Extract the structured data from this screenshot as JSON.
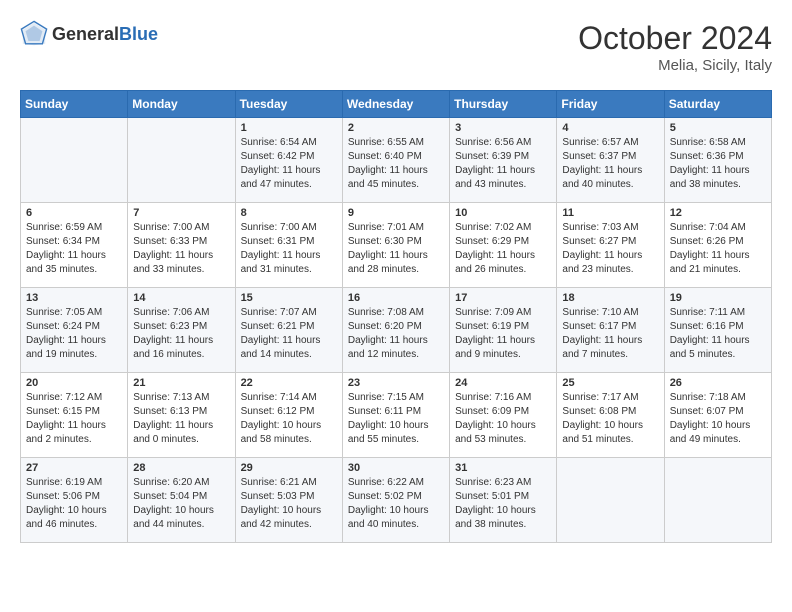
{
  "header": {
    "logo_general": "General",
    "logo_blue": "Blue",
    "month_title": "October 2024",
    "location": "Melia, Sicily, Italy"
  },
  "weekdays": [
    "Sunday",
    "Monday",
    "Tuesday",
    "Wednesday",
    "Thursday",
    "Friday",
    "Saturday"
  ],
  "weeks": [
    [
      {
        "day": "",
        "sunrise": "",
        "sunset": "",
        "daylight": ""
      },
      {
        "day": "",
        "sunrise": "",
        "sunset": "",
        "daylight": ""
      },
      {
        "day": "1",
        "sunrise": "Sunrise: 6:54 AM",
        "sunset": "Sunset: 6:42 PM",
        "daylight": "Daylight: 11 hours and 47 minutes."
      },
      {
        "day": "2",
        "sunrise": "Sunrise: 6:55 AM",
        "sunset": "Sunset: 6:40 PM",
        "daylight": "Daylight: 11 hours and 45 minutes."
      },
      {
        "day": "3",
        "sunrise": "Sunrise: 6:56 AM",
        "sunset": "Sunset: 6:39 PM",
        "daylight": "Daylight: 11 hours and 43 minutes."
      },
      {
        "day": "4",
        "sunrise": "Sunrise: 6:57 AM",
        "sunset": "Sunset: 6:37 PM",
        "daylight": "Daylight: 11 hours and 40 minutes."
      },
      {
        "day": "5",
        "sunrise": "Sunrise: 6:58 AM",
        "sunset": "Sunset: 6:36 PM",
        "daylight": "Daylight: 11 hours and 38 minutes."
      }
    ],
    [
      {
        "day": "6",
        "sunrise": "Sunrise: 6:59 AM",
        "sunset": "Sunset: 6:34 PM",
        "daylight": "Daylight: 11 hours and 35 minutes."
      },
      {
        "day": "7",
        "sunrise": "Sunrise: 7:00 AM",
        "sunset": "Sunset: 6:33 PM",
        "daylight": "Daylight: 11 hours and 33 minutes."
      },
      {
        "day": "8",
        "sunrise": "Sunrise: 7:00 AM",
        "sunset": "Sunset: 6:31 PM",
        "daylight": "Daylight: 11 hours and 31 minutes."
      },
      {
        "day": "9",
        "sunrise": "Sunrise: 7:01 AM",
        "sunset": "Sunset: 6:30 PM",
        "daylight": "Daylight: 11 hours and 28 minutes."
      },
      {
        "day": "10",
        "sunrise": "Sunrise: 7:02 AM",
        "sunset": "Sunset: 6:29 PM",
        "daylight": "Daylight: 11 hours and 26 minutes."
      },
      {
        "day": "11",
        "sunrise": "Sunrise: 7:03 AM",
        "sunset": "Sunset: 6:27 PM",
        "daylight": "Daylight: 11 hours and 23 minutes."
      },
      {
        "day": "12",
        "sunrise": "Sunrise: 7:04 AM",
        "sunset": "Sunset: 6:26 PM",
        "daylight": "Daylight: 11 hours and 21 minutes."
      }
    ],
    [
      {
        "day": "13",
        "sunrise": "Sunrise: 7:05 AM",
        "sunset": "Sunset: 6:24 PM",
        "daylight": "Daylight: 11 hours and 19 minutes."
      },
      {
        "day": "14",
        "sunrise": "Sunrise: 7:06 AM",
        "sunset": "Sunset: 6:23 PM",
        "daylight": "Daylight: 11 hours and 16 minutes."
      },
      {
        "day": "15",
        "sunrise": "Sunrise: 7:07 AM",
        "sunset": "Sunset: 6:21 PM",
        "daylight": "Daylight: 11 hours and 14 minutes."
      },
      {
        "day": "16",
        "sunrise": "Sunrise: 7:08 AM",
        "sunset": "Sunset: 6:20 PM",
        "daylight": "Daylight: 11 hours and 12 minutes."
      },
      {
        "day": "17",
        "sunrise": "Sunrise: 7:09 AM",
        "sunset": "Sunset: 6:19 PM",
        "daylight": "Daylight: 11 hours and 9 minutes."
      },
      {
        "day": "18",
        "sunrise": "Sunrise: 7:10 AM",
        "sunset": "Sunset: 6:17 PM",
        "daylight": "Daylight: 11 hours and 7 minutes."
      },
      {
        "day": "19",
        "sunrise": "Sunrise: 7:11 AM",
        "sunset": "Sunset: 6:16 PM",
        "daylight": "Daylight: 11 hours and 5 minutes."
      }
    ],
    [
      {
        "day": "20",
        "sunrise": "Sunrise: 7:12 AM",
        "sunset": "Sunset: 6:15 PM",
        "daylight": "Daylight: 11 hours and 2 minutes."
      },
      {
        "day": "21",
        "sunrise": "Sunrise: 7:13 AM",
        "sunset": "Sunset: 6:13 PM",
        "daylight": "Daylight: 11 hours and 0 minutes."
      },
      {
        "day": "22",
        "sunrise": "Sunrise: 7:14 AM",
        "sunset": "Sunset: 6:12 PM",
        "daylight": "Daylight: 10 hours and 58 minutes."
      },
      {
        "day": "23",
        "sunrise": "Sunrise: 7:15 AM",
        "sunset": "Sunset: 6:11 PM",
        "daylight": "Daylight: 10 hours and 55 minutes."
      },
      {
        "day": "24",
        "sunrise": "Sunrise: 7:16 AM",
        "sunset": "Sunset: 6:09 PM",
        "daylight": "Daylight: 10 hours and 53 minutes."
      },
      {
        "day": "25",
        "sunrise": "Sunrise: 7:17 AM",
        "sunset": "Sunset: 6:08 PM",
        "daylight": "Daylight: 10 hours and 51 minutes."
      },
      {
        "day": "26",
        "sunrise": "Sunrise: 7:18 AM",
        "sunset": "Sunset: 6:07 PM",
        "daylight": "Daylight: 10 hours and 49 minutes."
      }
    ],
    [
      {
        "day": "27",
        "sunrise": "Sunrise: 6:19 AM",
        "sunset": "Sunset: 5:06 PM",
        "daylight": "Daylight: 10 hours and 46 minutes."
      },
      {
        "day": "28",
        "sunrise": "Sunrise: 6:20 AM",
        "sunset": "Sunset: 5:04 PM",
        "daylight": "Daylight: 10 hours and 44 minutes."
      },
      {
        "day": "29",
        "sunrise": "Sunrise: 6:21 AM",
        "sunset": "Sunset: 5:03 PM",
        "daylight": "Daylight: 10 hours and 42 minutes."
      },
      {
        "day": "30",
        "sunrise": "Sunrise: 6:22 AM",
        "sunset": "Sunset: 5:02 PM",
        "daylight": "Daylight: 10 hours and 40 minutes."
      },
      {
        "day": "31",
        "sunrise": "Sunrise: 6:23 AM",
        "sunset": "Sunset: 5:01 PM",
        "daylight": "Daylight: 10 hours and 38 minutes."
      },
      {
        "day": "",
        "sunrise": "",
        "sunset": "",
        "daylight": ""
      },
      {
        "day": "",
        "sunrise": "",
        "sunset": "",
        "daylight": ""
      }
    ]
  ]
}
